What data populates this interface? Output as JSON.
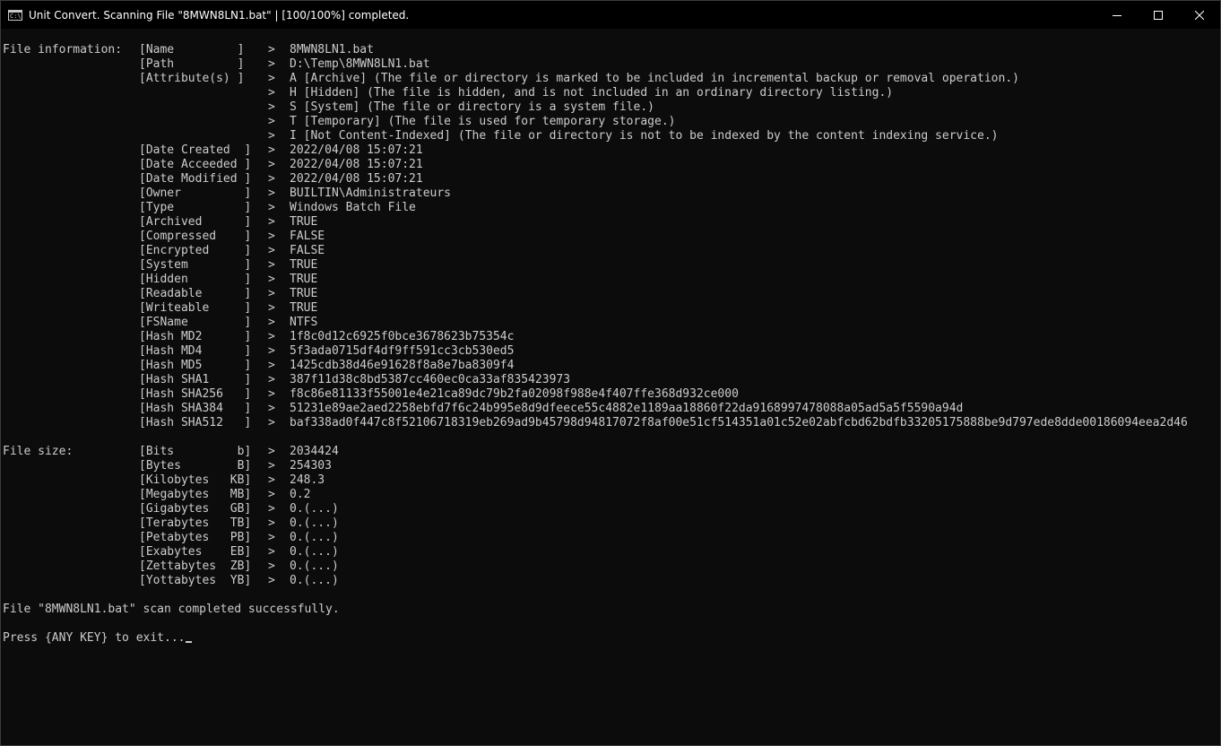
{
  "window": {
    "title": "Unit Convert. Scanning File \"8MWN8LN1.bat\" | [100/100%] completed.",
    "icon_text": "C:\\."
  },
  "sections": [
    {
      "label": "File information:",
      "rows": [
        {
          "key": "[Name         ]",
          "sep": ">",
          "value": "8MWN8LN1.bat"
        },
        {
          "key": "[Path         ]",
          "sep": ">",
          "value": "D:\\Temp\\8MWN8LN1.bat"
        },
        {
          "key": "[Attribute(s) ]",
          "sep": ">",
          "value": "A [Archive] (The file or directory is marked to be included in incremental backup or removal operation.)"
        },
        {
          "key": "",
          "sep": ">",
          "value": "H [Hidden] (The file is hidden, and is not included in an ordinary directory listing.)"
        },
        {
          "key": "",
          "sep": ">",
          "value": "S [System] (The file or directory is a system file.)"
        },
        {
          "key": "",
          "sep": ">",
          "value": "T [Temporary] (The file is used for temporary storage.)"
        },
        {
          "key": "",
          "sep": ">",
          "value": "I [Not Content-Indexed] (The file or directory is not to be indexed by the content indexing service.)"
        },
        {
          "key": "[Date Created  ]",
          "sep": ">",
          "value": "2022/04/08 15:07:21"
        },
        {
          "key": "[Date Acceeded ]",
          "sep": ">",
          "value": "2022/04/08 15:07:21"
        },
        {
          "key": "[Date Modified ]",
          "sep": ">",
          "value": "2022/04/08 15:07:21"
        },
        {
          "key": "[Owner         ]",
          "sep": ">",
          "value": "BUILTIN\\Administrateurs"
        },
        {
          "key": "[Type          ]",
          "sep": ">",
          "value": "Windows Batch File"
        },
        {
          "key": "[Archived      ]",
          "sep": ">",
          "value": "TRUE"
        },
        {
          "key": "[Compressed    ]",
          "sep": ">",
          "value": "FALSE"
        },
        {
          "key": "[Encrypted     ]",
          "sep": ">",
          "value": "FALSE"
        },
        {
          "key": "[System        ]",
          "sep": ">",
          "value": "TRUE"
        },
        {
          "key": "[Hidden        ]",
          "sep": ">",
          "value": "TRUE"
        },
        {
          "key": "[Readable      ]",
          "sep": ">",
          "value": "TRUE"
        },
        {
          "key": "[Writeable     ]",
          "sep": ">",
          "value": "TRUE"
        },
        {
          "key": "[FSName        ]",
          "sep": ">",
          "value": "NTFS"
        },
        {
          "key": "[Hash MD2      ]",
          "sep": ">",
          "value": "1f8c0d12c6925f0bce3678623b75354c"
        },
        {
          "key": "[Hash MD4      ]",
          "sep": ">",
          "value": "5f3ada0715df4df9ff591cc3cb530ed5"
        },
        {
          "key": "[Hash MD5      ]",
          "sep": ">",
          "value": "1425cdb38d46e91628f8a8e7ba8309f4"
        },
        {
          "key": "[Hash SHA1     ]",
          "sep": ">",
          "value": "387f11d38c8bd5387cc460ec0ca33af835423973"
        },
        {
          "key": "[Hash SHA256   ]",
          "sep": ">",
          "value": "f8c86e81133f55001e4e21ca89dc79b2fa02098f988e4f407ffe368d932ce000"
        },
        {
          "key": "[Hash SHA384   ]",
          "sep": ">",
          "value": "51231e89ae2aed2258ebfd7f6c24b995e8d9dfeece55c4882e1189aa18860f22da9168997478088a05ad5a5f5590a94d"
        },
        {
          "key": "[Hash SHA512   ]",
          "sep": ">",
          "value": "baf338ad0f447c8f52106718319eb269ad9b45798d94817072f8af00e51cf514351a01c52e02abfcbd62bdfb33205175888be9d797ede8dde00186094eea2d46"
        }
      ]
    },
    {
      "label": "File size:",
      "rows": [
        {
          "key": "[Bits         b]",
          "sep": ">",
          "value": "2034424"
        },
        {
          "key": "[Bytes        B]",
          "sep": ">",
          "value": "254303"
        },
        {
          "key": "[Kilobytes   KB]",
          "sep": ">",
          "value": "248.3"
        },
        {
          "key": "[Megabytes   MB]",
          "sep": ">",
          "value": "0.2"
        },
        {
          "key": "[Gigabytes   GB]",
          "sep": ">",
          "value": "0.(...)"
        },
        {
          "key": "[Terabytes   TB]",
          "sep": ">",
          "value": "0.(...)"
        },
        {
          "key": "[Petabytes   PB]",
          "sep": ">",
          "value": "0.(...)"
        },
        {
          "key": "[Exabytes    EB]",
          "sep": ">",
          "value": "0.(...)"
        },
        {
          "key": "[Zettabytes  ZB]",
          "sep": ">",
          "value": "0.(...)"
        },
        {
          "key": "[Yottabytes  YB]",
          "sep": ">",
          "value": "0.(...)"
        }
      ]
    }
  ],
  "footer": {
    "status": "File \"8MWN8LN1.bat\" scan completed successfully.",
    "prompt": "Press {ANY KEY} to exit..."
  },
  "colors": {
    "background": "#0c0c0c",
    "foreground": "#cccccc",
    "titlebar": "#000000"
  },
  "icons": [
    "console-app-icon",
    "minimize-icon",
    "maximize-icon",
    "close-icon"
  ]
}
